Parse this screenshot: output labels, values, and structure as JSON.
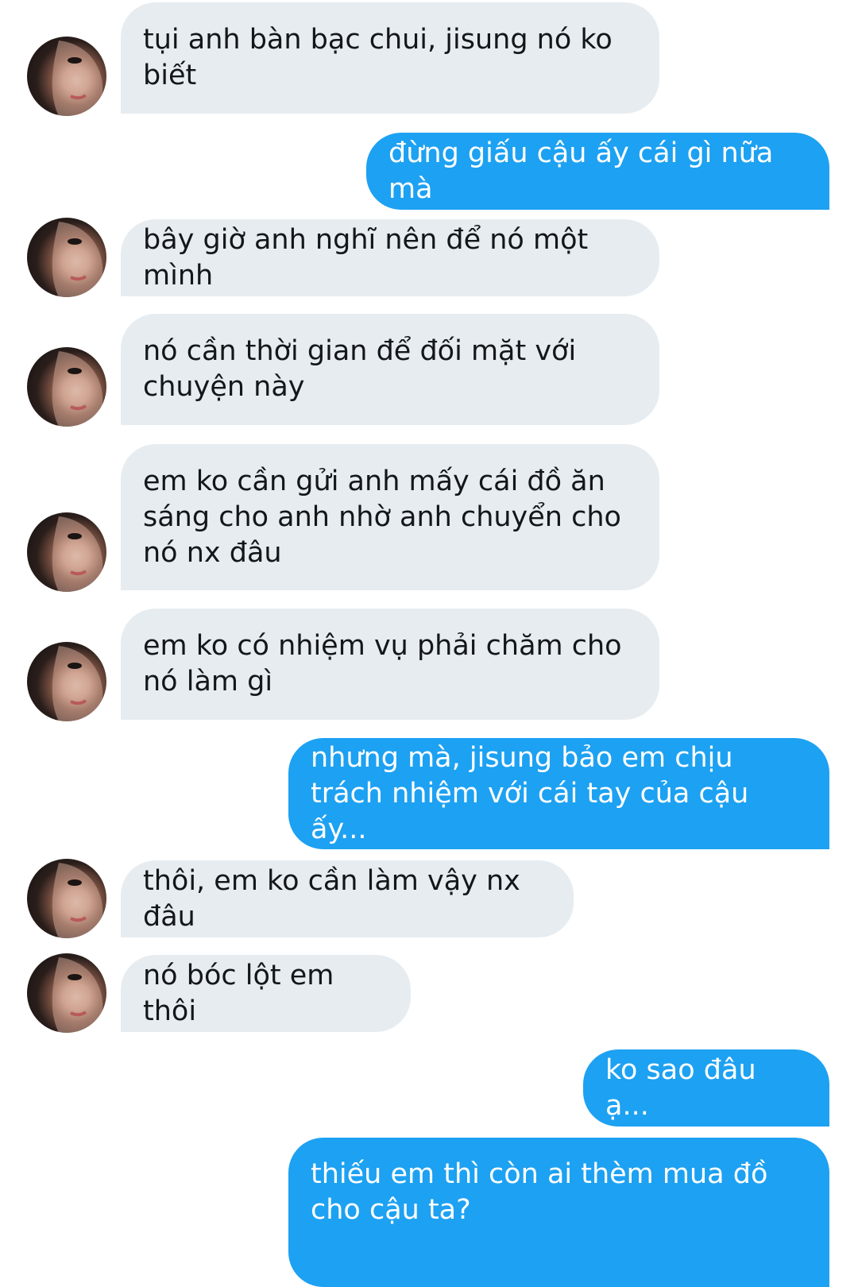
{
  "messages": [
    {
      "from": "them",
      "text": "tụi anh bàn bạc chui, jisung nó ko biết"
    },
    {
      "from": "me",
      "text": "đừng giấu cậu ấy cái gì nữa mà"
    },
    {
      "from": "them",
      "text": "bây giờ anh nghĩ nên để nó một mình"
    },
    {
      "from": "them",
      "text": "nó cần thời gian để đối mặt với chuyện này"
    },
    {
      "from": "them",
      "text": "em ko cần gửi anh mấy cái đồ ăn sáng cho anh nhờ anh chuyển cho nó nx đâu"
    },
    {
      "from": "them",
      "text": "em ko có nhiệm vụ phải chăm cho nó làm gì"
    },
    {
      "from": "me",
      "text": "nhưng mà, jisung bảo em chịu trách nhiệm với cái tay của cậu ấy..."
    },
    {
      "from": "them",
      "text": "thôi, em ko cần làm vậy nx đâu"
    },
    {
      "from": "them",
      "text": "nó bóc lột em thôi"
    },
    {
      "from": "me",
      "text": "ko sao đâu ạ..."
    },
    {
      "from": "me",
      "text": "thiếu em thì còn ai thèm mua đồ cho cậu ta?"
    }
  ],
  "colors": {
    "sent_bubble": "#1da1f2",
    "received_bubble": "#e6ecf0",
    "received_text": "#14171a",
    "sent_text": "#ffffff"
  },
  "icons": {
    "avatar": "contact-avatar-photo"
  }
}
